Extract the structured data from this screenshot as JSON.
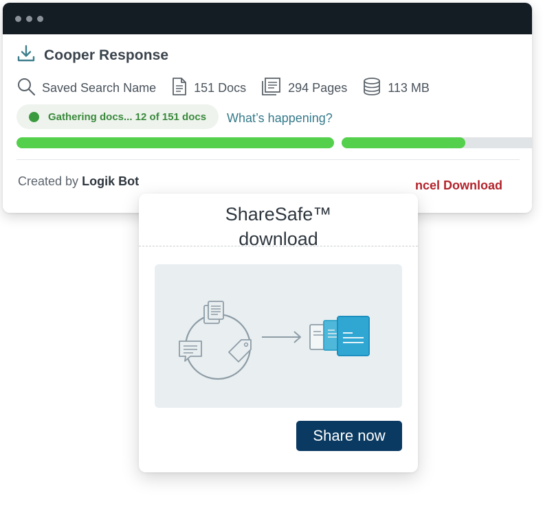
{
  "window": {
    "title": "Cooper Response",
    "meta": {
      "search_name": "Saved Search Name",
      "docs": "151 Docs",
      "pages": "294 Pages",
      "size": "113 MB"
    },
    "status": {
      "text": "Gathering docs... 12 of 151 docs",
      "help_link": "What’s happening?",
      "progress_bars": [
        1.0,
        0.6
      ]
    },
    "footer": {
      "created_prefix": "Created by",
      "created_by": "Logik Bot",
      "cancel_label": "ncel Download"
    }
  },
  "card": {
    "title_line1": "ShareSafe™",
    "title_line2": "download",
    "button_label": "Share now"
  },
  "colors": {
    "titlebar": "#141c24",
    "progress": "#54d04c",
    "status_text": "#3a8a3c",
    "link": "#357a8a",
    "cancel": "#b3232b",
    "button": "#0a3a62",
    "teal_accent": "#2aa0c8"
  }
}
